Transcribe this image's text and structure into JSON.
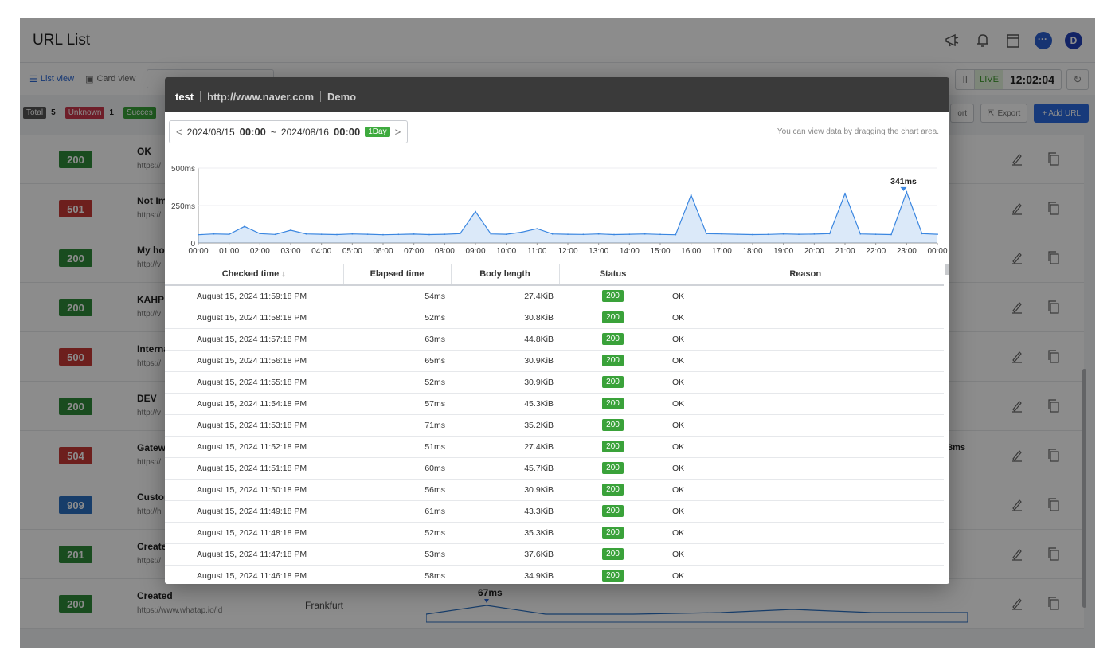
{
  "page": {
    "title": "URL List",
    "views": {
      "list": "List view",
      "card": "Card view"
    },
    "live": {
      "label": "LIVE",
      "time": "12:02:04",
      "pause_icon": "pause-icon",
      "refresh_icon": "refresh-icon"
    },
    "counts": [
      {
        "label": "Total",
        "value": "5",
        "color": "#555555"
      },
      {
        "label": "Unknown",
        "value": "1",
        "color": "#c9384b"
      },
      {
        "label": "Succes",
        "value": "",
        "color": "#3aa23a"
      }
    ],
    "buttons": {
      "import": "ort",
      "export": "Export",
      "add_url": "+ Add URL"
    }
  },
  "rows": [
    {
      "code": "200",
      "color": "#2e8b3a",
      "name": "OK",
      "url": "https://",
      "location": ""
    },
    {
      "code": "501",
      "color": "#c63a36",
      "name": "Not Im",
      "url": "https://",
      "location": ""
    },
    {
      "code": "200",
      "color": "#2e8b3a",
      "name": "My hor",
      "url": "http://v",
      "location": ""
    },
    {
      "code": "200",
      "color": "#2e8b3a",
      "name": "KAHP",
      "url": "http://v",
      "location": ""
    },
    {
      "code": "500",
      "color": "#c63a36",
      "name": "Interna",
      "url": "https://",
      "location": ""
    },
    {
      "code": "200",
      "color": "#2e8b3a",
      "name": "DEV",
      "url": "http://v",
      "location": ""
    },
    {
      "code": "504",
      "color": "#c63a36",
      "name": "Gatew",
      "url": "https://",
      "location": ""
    },
    {
      "code": "909",
      "color": "#2a6fc2",
      "name": "Custor",
      "url": "http://h",
      "location": ""
    },
    {
      "code": "201",
      "color": "#2e8b3a",
      "name": "Create",
      "url": "https://",
      "location": ""
    },
    {
      "code": "200",
      "color": "#2e8b3a",
      "name": "Created",
      "url": "https://www.whatap.io/id",
      "location": "Frankfurt",
      "peak": "67ms"
    }
  ],
  "partial_label": "3ms",
  "modal": {
    "name": "test",
    "url": "http://www.naver.com",
    "tag": "Demo",
    "range_start_date": "2024/08/15",
    "range_start_time": "00:00",
    "range_end_date": "2024/08/16",
    "range_end_time": "00:00",
    "range_sep": "~",
    "period": "1Day",
    "hint": "You can view data by dragging the chart area."
  },
  "chart_data": {
    "type": "line",
    "ylabels": [
      "500ms",
      "250ms",
      "0"
    ],
    "yticks": [
      500,
      250,
      0
    ],
    "ylim": [
      0,
      500
    ],
    "xticks": [
      "00:00",
      "01:00",
      "02:00",
      "03:00",
      "04:00",
      "05:00",
      "06:00",
      "07:00",
      "08:00",
      "09:00",
      "10:00",
      "11:00",
      "12:00",
      "13:00",
      "14:00",
      "15:00",
      "16:00",
      "17:00",
      "18:00",
      "19:00",
      "20:00",
      "21:00",
      "22:00",
      "23:00",
      "00:00"
    ],
    "x": [
      "00:00",
      "00:30",
      "01:00",
      "01:30",
      "02:00",
      "02:30",
      "03:00",
      "03:30",
      "04:00",
      "04:30",
      "05:00",
      "05:30",
      "06:00",
      "06:30",
      "07:00",
      "07:30",
      "08:00",
      "08:30",
      "09:00",
      "09:30",
      "10:00",
      "10:30",
      "11:00",
      "11:30",
      "12:00",
      "12:30",
      "13:00",
      "13:30",
      "14:00",
      "14:30",
      "15:00",
      "15:30",
      "16:00",
      "16:30",
      "17:00",
      "17:30",
      "18:00",
      "18:30",
      "19:00",
      "19:30",
      "20:00",
      "20:30",
      "21:00",
      "21:30",
      "22:00",
      "22:30",
      "23:00",
      "23:30",
      "00:00"
    ],
    "y": [
      55,
      60,
      58,
      110,
      62,
      57,
      85,
      60,
      58,
      56,
      60,
      58,
      55,
      57,
      59,
      56,
      58,
      62,
      210,
      60,
      58,
      72,
      95,
      60,
      58,
      57,
      60,
      56,
      58,
      60,
      57,
      55,
      320,
      62,
      60,
      58,
      56,
      57,
      60,
      58,
      59,
      62,
      330,
      60,
      58,
      56,
      341,
      62,
      58
    ],
    "peak_label": "341ms",
    "peak_x": "22:54",
    "peak_value": 341,
    "color": "#3a86e0"
  },
  "table": {
    "headers": [
      "Checked time ↓",
      "Elapsed time",
      "Body length",
      "Status",
      "Reason"
    ],
    "rows": [
      {
        "time": "August 15, 2024 11:59:18 PM",
        "elapsed": "54ms",
        "body": "27.4KiB",
        "status": "200",
        "reason": "OK"
      },
      {
        "time": "August 15, 2024 11:58:18 PM",
        "elapsed": "52ms",
        "body": "30.8KiB",
        "status": "200",
        "reason": "OK"
      },
      {
        "time": "August 15, 2024 11:57:18 PM",
        "elapsed": "63ms",
        "body": "44.8KiB",
        "status": "200",
        "reason": "OK"
      },
      {
        "time": "August 15, 2024 11:56:18 PM",
        "elapsed": "65ms",
        "body": "30.9KiB",
        "status": "200",
        "reason": "OK"
      },
      {
        "time": "August 15, 2024 11:55:18 PM",
        "elapsed": "52ms",
        "body": "30.9KiB",
        "status": "200",
        "reason": "OK"
      },
      {
        "time": "August 15, 2024 11:54:18 PM",
        "elapsed": "57ms",
        "body": "45.3KiB",
        "status": "200",
        "reason": "OK"
      },
      {
        "time": "August 15, 2024 11:53:18 PM",
        "elapsed": "71ms",
        "body": "35.2KiB",
        "status": "200",
        "reason": "OK"
      },
      {
        "time": "August 15, 2024 11:52:18 PM",
        "elapsed": "51ms",
        "body": "27.4KiB",
        "status": "200",
        "reason": "OK"
      },
      {
        "time": "August 15, 2024 11:51:18 PM",
        "elapsed": "60ms",
        "body": "45.7KiB",
        "status": "200",
        "reason": "OK"
      },
      {
        "time": "August 15, 2024 11:50:18 PM",
        "elapsed": "56ms",
        "body": "30.9KiB",
        "status": "200",
        "reason": "OK"
      },
      {
        "time": "August 15, 2024 11:49:18 PM",
        "elapsed": "61ms",
        "body": "43.3KiB",
        "status": "200",
        "reason": "OK"
      },
      {
        "time": "August 15, 2024 11:48:18 PM",
        "elapsed": "52ms",
        "body": "35.3KiB",
        "status": "200",
        "reason": "OK"
      },
      {
        "time": "August 15, 2024 11:47:18 PM",
        "elapsed": "53ms",
        "body": "37.6KiB",
        "status": "200",
        "reason": "OK"
      },
      {
        "time": "August 15, 2024 11:46:18 PM",
        "elapsed": "58ms",
        "body": "34.9KiB",
        "status": "200",
        "reason": "OK"
      }
    ]
  }
}
